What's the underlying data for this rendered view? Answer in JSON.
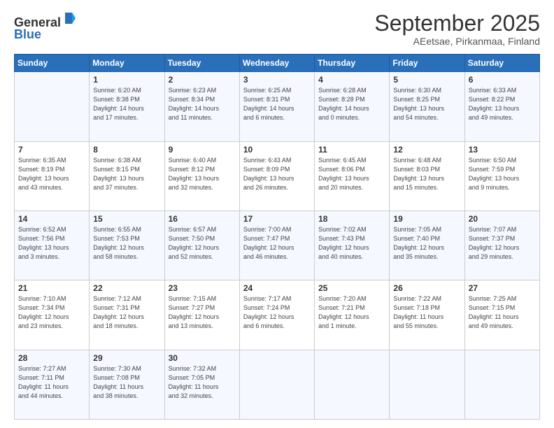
{
  "header": {
    "logo_line1": "General",
    "logo_line2": "Blue",
    "month": "September 2025",
    "location": "AEetsae, Pirkanmaa, Finland"
  },
  "days_of_week": [
    "Sunday",
    "Monday",
    "Tuesday",
    "Wednesday",
    "Thursday",
    "Friday",
    "Saturday"
  ],
  "weeks": [
    [
      {
        "day": "",
        "detail": ""
      },
      {
        "day": "1",
        "detail": "Sunrise: 6:20 AM\nSunset: 8:38 PM\nDaylight: 14 hours\nand 17 minutes."
      },
      {
        "day": "2",
        "detail": "Sunrise: 6:23 AM\nSunset: 8:34 PM\nDaylight: 14 hours\nand 11 minutes."
      },
      {
        "day": "3",
        "detail": "Sunrise: 6:25 AM\nSunset: 8:31 PM\nDaylight: 14 hours\nand 6 minutes."
      },
      {
        "day": "4",
        "detail": "Sunrise: 6:28 AM\nSunset: 8:28 PM\nDaylight: 14 hours\nand 0 minutes."
      },
      {
        "day": "5",
        "detail": "Sunrise: 6:30 AM\nSunset: 8:25 PM\nDaylight: 13 hours\nand 54 minutes."
      },
      {
        "day": "6",
        "detail": "Sunrise: 6:33 AM\nSunset: 8:22 PM\nDaylight: 13 hours\nand 49 minutes."
      }
    ],
    [
      {
        "day": "7",
        "detail": "Sunrise: 6:35 AM\nSunset: 8:19 PM\nDaylight: 13 hours\nand 43 minutes."
      },
      {
        "day": "8",
        "detail": "Sunrise: 6:38 AM\nSunset: 8:15 PM\nDaylight: 13 hours\nand 37 minutes."
      },
      {
        "day": "9",
        "detail": "Sunrise: 6:40 AM\nSunset: 8:12 PM\nDaylight: 13 hours\nand 32 minutes."
      },
      {
        "day": "10",
        "detail": "Sunrise: 6:43 AM\nSunset: 8:09 PM\nDaylight: 13 hours\nand 26 minutes."
      },
      {
        "day": "11",
        "detail": "Sunrise: 6:45 AM\nSunset: 8:06 PM\nDaylight: 13 hours\nand 20 minutes."
      },
      {
        "day": "12",
        "detail": "Sunrise: 6:48 AM\nSunset: 8:03 PM\nDaylight: 13 hours\nand 15 minutes."
      },
      {
        "day": "13",
        "detail": "Sunrise: 6:50 AM\nSunset: 7:59 PM\nDaylight: 13 hours\nand 9 minutes."
      }
    ],
    [
      {
        "day": "14",
        "detail": "Sunrise: 6:52 AM\nSunset: 7:56 PM\nDaylight: 13 hours\nand 3 minutes."
      },
      {
        "day": "15",
        "detail": "Sunrise: 6:55 AM\nSunset: 7:53 PM\nDaylight: 12 hours\nand 58 minutes."
      },
      {
        "day": "16",
        "detail": "Sunrise: 6:57 AM\nSunset: 7:50 PM\nDaylight: 12 hours\nand 52 minutes."
      },
      {
        "day": "17",
        "detail": "Sunrise: 7:00 AM\nSunset: 7:47 PM\nDaylight: 12 hours\nand 46 minutes."
      },
      {
        "day": "18",
        "detail": "Sunrise: 7:02 AM\nSunset: 7:43 PM\nDaylight: 12 hours\nand 40 minutes."
      },
      {
        "day": "19",
        "detail": "Sunrise: 7:05 AM\nSunset: 7:40 PM\nDaylight: 12 hours\nand 35 minutes."
      },
      {
        "day": "20",
        "detail": "Sunrise: 7:07 AM\nSunset: 7:37 PM\nDaylight: 12 hours\nand 29 minutes."
      }
    ],
    [
      {
        "day": "21",
        "detail": "Sunrise: 7:10 AM\nSunset: 7:34 PM\nDaylight: 12 hours\nand 23 minutes."
      },
      {
        "day": "22",
        "detail": "Sunrise: 7:12 AM\nSunset: 7:31 PM\nDaylight: 12 hours\nand 18 minutes."
      },
      {
        "day": "23",
        "detail": "Sunrise: 7:15 AM\nSunset: 7:27 PM\nDaylight: 12 hours\nand 13 minutes."
      },
      {
        "day": "24",
        "detail": "Sunrise: 7:17 AM\nSunset: 7:24 PM\nDaylight: 12 hours\nand 6 minutes."
      },
      {
        "day": "25",
        "detail": "Sunrise: 7:20 AM\nSunset: 7:21 PM\nDaylight: 12 hours\nand 1 minute."
      },
      {
        "day": "26",
        "detail": "Sunrise: 7:22 AM\nSunset: 7:18 PM\nDaylight: 11 hours\nand 55 minutes."
      },
      {
        "day": "27",
        "detail": "Sunrise: 7:25 AM\nSunset: 7:15 PM\nDaylight: 11 hours\nand 49 minutes."
      }
    ],
    [
      {
        "day": "28",
        "detail": "Sunrise: 7:27 AM\nSunset: 7:11 PM\nDaylight: 11 hours\nand 44 minutes."
      },
      {
        "day": "29",
        "detail": "Sunrise: 7:30 AM\nSunset: 7:08 PM\nDaylight: 11 hours\nand 38 minutes."
      },
      {
        "day": "30",
        "detail": "Sunrise: 7:32 AM\nSunset: 7:05 PM\nDaylight: 11 hours\nand 32 minutes."
      },
      {
        "day": "",
        "detail": ""
      },
      {
        "day": "",
        "detail": ""
      },
      {
        "day": "",
        "detail": ""
      },
      {
        "day": "",
        "detail": ""
      }
    ]
  ]
}
